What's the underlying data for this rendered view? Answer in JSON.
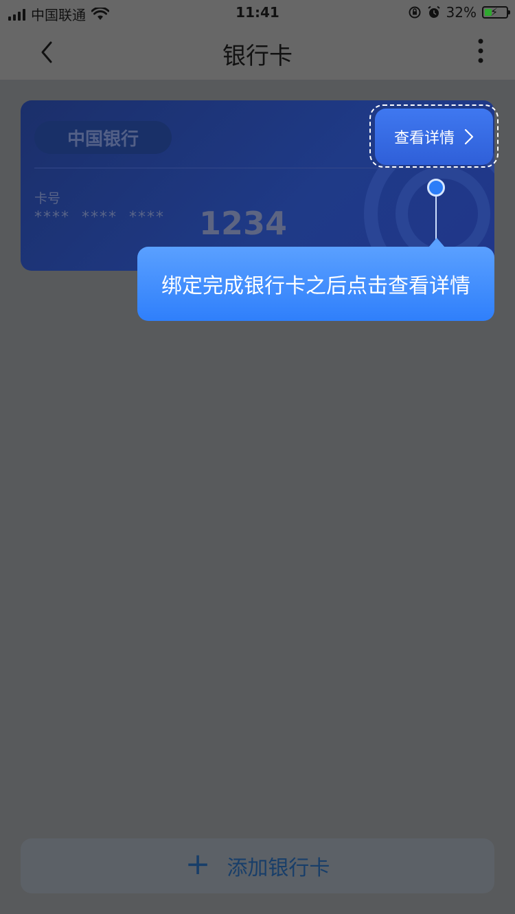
{
  "status_bar": {
    "carrier": "中国联通",
    "time": "11:41",
    "battery_percent": "32%",
    "battery_level": 0.32,
    "icons": [
      "signal-icon",
      "wifi-icon",
      "rotation-lock-icon",
      "alarm-icon",
      "battery-charging-icon"
    ]
  },
  "nav": {
    "title": "银行卡",
    "back_icon": "chevron-left-icon",
    "more_icon": "more-vertical-icon"
  },
  "card": {
    "bank_name": "中国银行",
    "number_label": "卡号",
    "masked_number": "**** **** ****",
    "last_four": "1234",
    "details_button": "查看详情",
    "details_icon": "chevron-right-icon"
  },
  "guide": {
    "tooltip_text": "绑定完成银行卡之后点击查看详情"
  },
  "footer": {
    "add_button": "添加银行卡",
    "add_icon": "plus-icon"
  },
  "colors": {
    "overlay_bg": "#585a5c",
    "card_bg": "#1f3a87",
    "tooltip_bg": "#2f7ffb",
    "details_bg": "#3f78f0",
    "add_button_text": "#183e69"
  }
}
